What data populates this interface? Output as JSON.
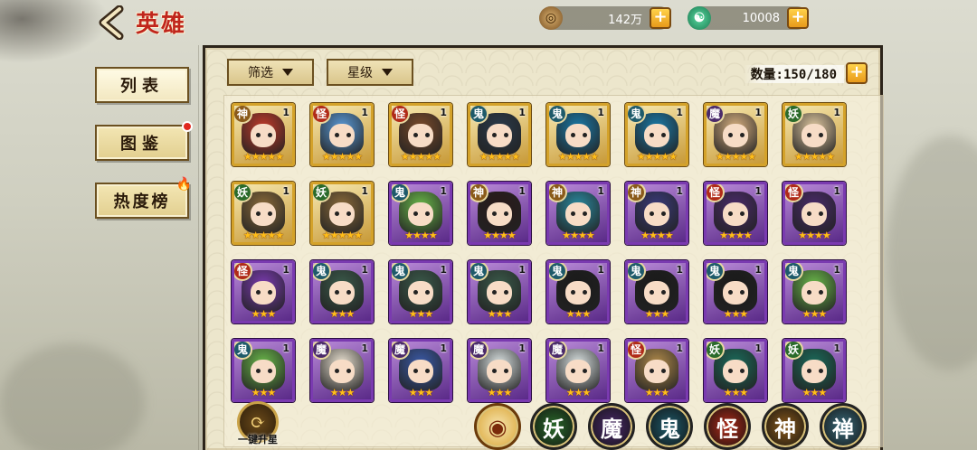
{
  "header": {
    "title": "英雄",
    "coins": "142万",
    "jade": "10008"
  },
  "sidebar": {
    "items": [
      {
        "label": "列表",
        "active": true
      },
      {
        "label": "图鉴",
        "badge": "red-dot"
      },
      {
        "label": "热度榜",
        "badge": "flame"
      }
    ]
  },
  "toolbar": {
    "filter_label": "筛选",
    "star_label": "星级",
    "count_text": "数量:150/180"
  },
  "bottom": {
    "upgrade_label": "一键升星",
    "factions": [
      "妖",
      "魔",
      "鬼",
      "怪",
      "神",
      "禅"
    ]
  },
  "faction_colors": {
    "神": "#8a5a1a",
    "怪": "#b02a18",
    "鬼": "#1e5a6a",
    "魔": "#4a2a6a",
    "妖": "#2a6a2a",
    "禅": "#3a6a7a"
  },
  "heroes": [
    {
      "faction": "神",
      "level": "1",
      "frame": "gold",
      "stars": 5,
      "hue": "#c23a2a"
    },
    {
      "faction": "怪",
      "level": "1",
      "frame": "gold",
      "stars": 5,
      "hue": "#5a9ad8"
    },
    {
      "faction": "怪",
      "level": "1",
      "frame": "gold",
      "stars": 5,
      "hue": "#7a4a2a"
    },
    {
      "faction": "鬼",
      "level": "1",
      "frame": "gold",
      "stars": 5,
      "hue": "#2a3a4a"
    },
    {
      "faction": "鬼",
      "level": "1",
      "frame": "gold",
      "stars": 5,
      "hue": "#1a7aa8"
    },
    {
      "faction": "鬼",
      "level": "1",
      "frame": "gold",
      "stars": 5,
      "hue": "#1a7aa8"
    },
    {
      "faction": "魔",
      "level": "1",
      "frame": "gold",
      "stars": 5,
      "hue": "#d8b080"
    },
    {
      "faction": "妖",
      "level": "1",
      "frame": "gold",
      "stars": 5,
      "hue": "#e0c8a0"
    },
    {
      "faction": "妖",
      "level": "1",
      "frame": "gold",
      "stars": 5,
      "hue": "#8a6a3a"
    },
    {
      "faction": "妖",
      "level": "1",
      "frame": "gold",
      "stars": 5,
      "hue": "#8a6a3a"
    },
    {
      "faction": "鬼",
      "level": "1",
      "frame": "purple",
      "stars": 4,
      "hue": "#6ab84a"
    },
    {
      "faction": "神",
      "level": "1",
      "frame": "purple",
      "stars": 4,
      "hue": "#2a1a1a"
    },
    {
      "faction": "神",
      "level": "1",
      "frame": "purple",
      "stars": 4,
      "hue": "#2a8aa0"
    },
    {
      "faction": "神",
      "level": "1",
      "frame": "purple",
      "stars": 4,
      "hue": "#3a3a7a"
    },
    {
      "faction": "怪",
      "level": "1",
      "frame": "purple",
      "stars": 4,
      "hue": "#4a2a6a"
    },
    {
      "faction": "怪",
      "level": "1",
      "frame": "purple",
      "stars": 4,
      "hue": "#4a2a6a"
    },
    {
      "faction": "怪",
      "level": "1",
      "frame": "purple",
      "stars": 3,
      "hue": "#7a3ab0"
    },
    {
      "faction": "鬼",
      "level": "1",
      "frame": "purple",
      "stars": 3,
      "hue": "#3a5a4a"
    },
    {
      "faction": "鬼",
      "level": "1",
      "frame": "purple",
      "stars": 3,
      "hue": "#3a5a4a"
    },
    {
      "faction": "鬼",
      "level": "1",
      "frame": "purple",
      "stars": 3,
      "hue": "#3a5a4a"
    },
    {
      "faction": "鬼",
      "level": "1",
      "frame": "purple",
      "stars": 3,
      "hue": "#1a1a1a"
    },
    {
      "faction": "鬼",
      "level": "1",
      "frame": "purple",
      "stars": 3,
      "hue": "#1a1a1a"
    },
    {
      "faction": "鬼",
      "level": "1",
      "frame": "purple",
      "stars": 3,
      "hue": "#1a1a1a"
    },
    {
      "faction": "鬼",
      "level": "1",
      "frame": "purple",
      "stars": 3,
      "hue": "#6ab84a"
    },
    {
      "faction": "鬼",
      "level": "1",
      "frame": "purple",
      "stars": 3,
      "hue": "#6ab84a"
    },
    {
      "faction": "魔",
      "level": "1",
      "frame": "purple",
      "stars": 3,
      "hue": "#e8e0d0"
    },
    {
      "faction": "魔",
      "level": "1",
      "frame": "purple",
      "stars": 3,
      "hue": "#3a5aa8"
    },
    {
      "faction": "魔",
      "level": "1",
      "frame": "purple",
      "stars": 3,
      "hue": "#d8e0e0"
    },
    {
      "faction": "魔",
      "level": "1",
      "frame": "purple",
      "stars": 3,
      "hue": "#d8e0e0"
    },
    {
      "faction": "怪",
      "level": "1",
      "frame": "purple",
      "stars": 3,
      "hue": "#b08a4a"
    },
    {
      "faction": "妖",
      "level": "1",
      "frame": "purple",
      "stars": 3,
      "hue": "#1a6a5a"
    },
    {
      "faction": "妖",
      "level": "1",
      "frame": "purple",
      "stars": 3,
      "hue": "#1a6a5a"
    }
  ]
}
